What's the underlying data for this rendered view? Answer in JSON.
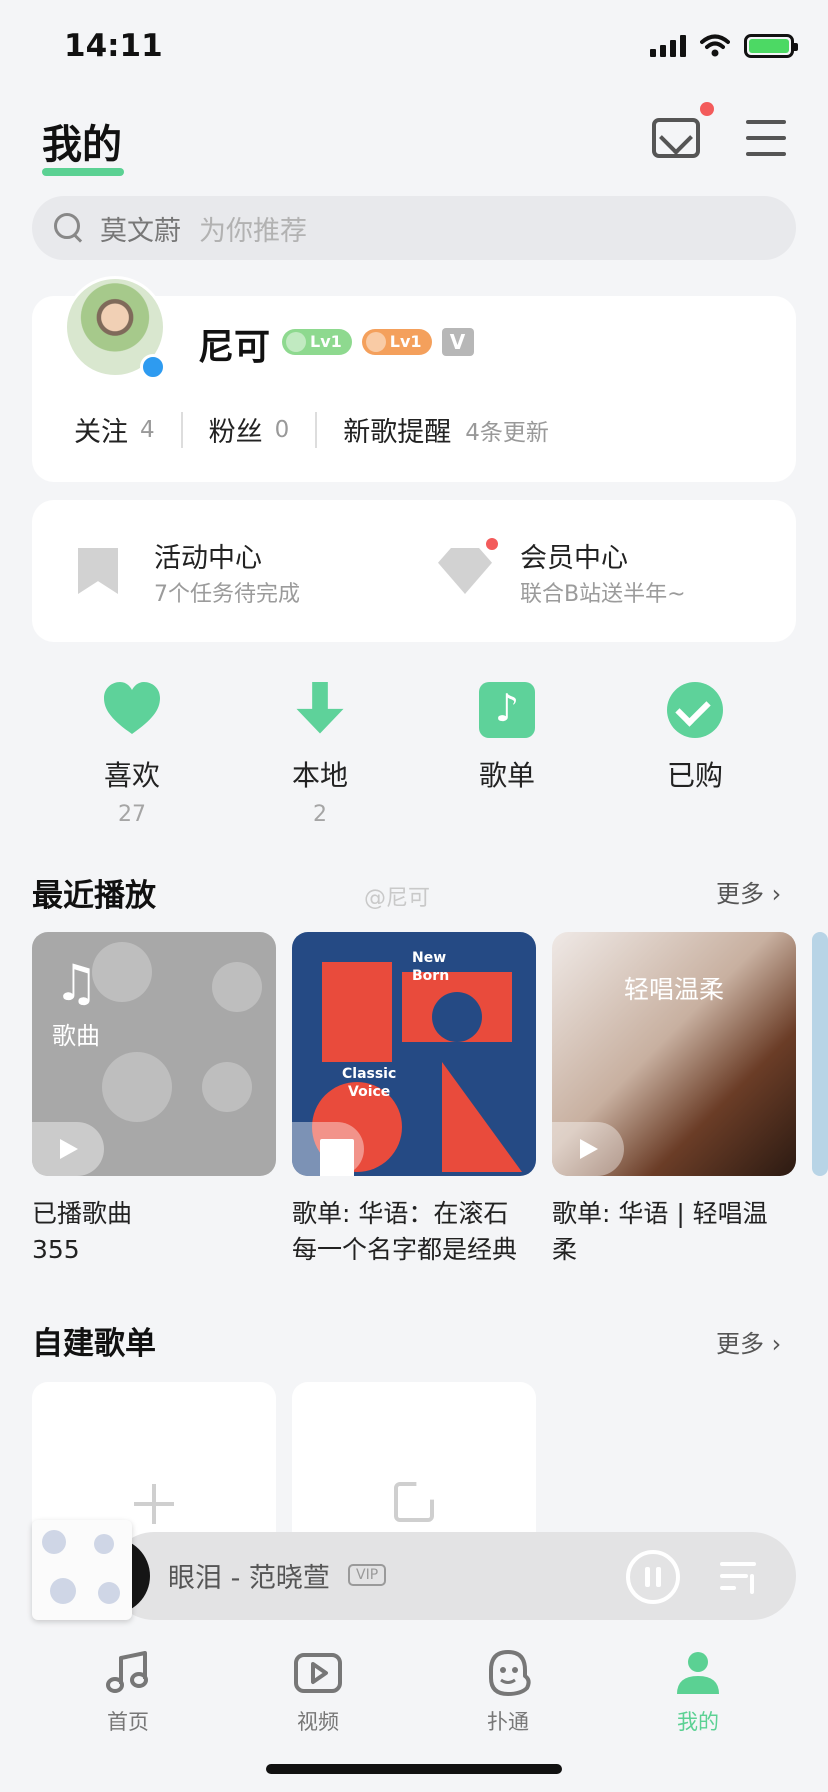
{
  "status": {
    "time": "14:11"
  },
  "header": {
    "title": "我的"
  },
  "search": {
    "text": "莫文蔚",
    "hint": "为你推荐"
  },
  "profile": {
    "name": "尼可",
    "badge1": "Lv1",
    "badge2": "Lv1",
    "badge3": "V",
    "follow_label": "关注",
    "follow_count": "4",
    "fans_label": "粉丝",
    "fans_count": "0",
    "remind_label": "新歌提醒",
    "remind_sub": "4条更新"
  },
  "activity": {
    "left_title": "活动中心",
    "left_sub": "7个任务待完成",
    "right_title": "会员中心",
    "right_sub": "联合B站送半年~"
  },
  "quick": [
    {
      "label": "喜欢",
      "count": "27"
    },
    {
      "label": "本地",
      "count": "2"
    },
    {
      "label": "歌单",
      "count": ""
    },
    {
      "label": "已购",
      "count": ""
    }
  ],
  "recent": {
    "title": "最近播放",
    "more": "更多",
    "watermark": "@尼可",
    "tiles": [
      {
        "tag": "歌曲",
        "caption1": "已播歌曲",
        "caption2": "355"
      },
      {
        "caption1": "歌单: 华语：在滚石",
        "caption2": "每一个名字都是经典",
        "t1": "New",
        "t2": "Born",
        "t3": "Classic",
        "t4": "Voice"
      },
      {
        "title": "轻唱温柔",
        "caption1": "歌单: 华语 | 轻唱温",
        "caption2": "柔"
      }
    ]
  },
  "own": {
    "title": "自建歌单",
    "more": "更多"
  },
  "player": {
    "song": "眼泪 - 范晓萱",
    "vip": "VIP"
  },
  "tabs": [
    {
      "label": "首页"
    },
    {
      "label": "视频"
    },
    {
      "label": "扑通"
    },
    {
      "label": "我的"
    }
  ],
  "colors": {
    "accent": "#5bd193",
    "notify": "#f35b5b"
  }
}
